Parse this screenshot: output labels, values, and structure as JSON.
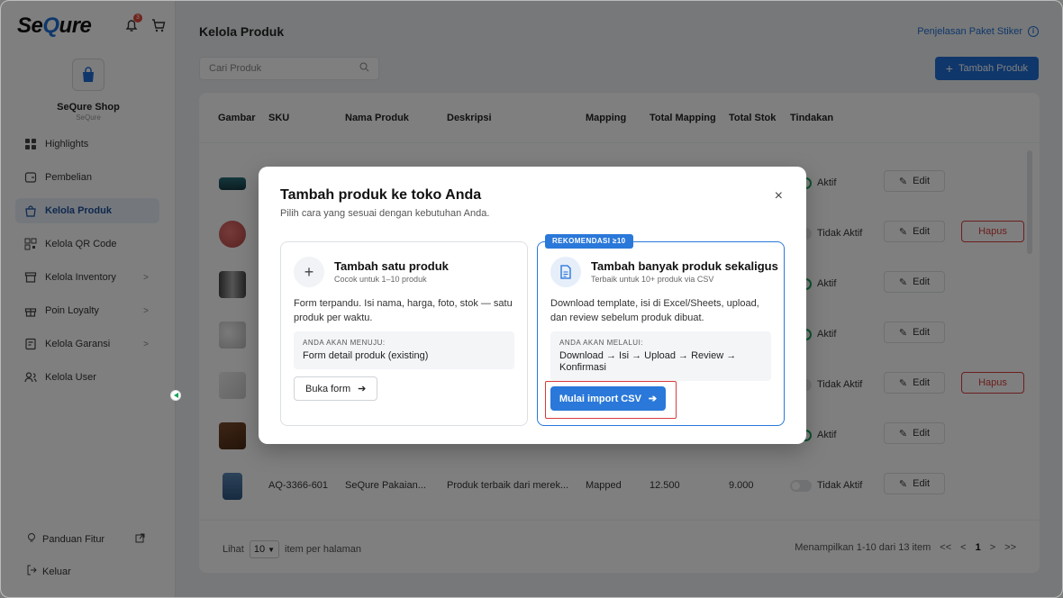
{
  "app": {
    "logo_text_before": "Se",
    "logo_text_q": "Q",
    "logo_text_after": "ure",
    "notification_count": "3"
  },
  "shop": {
    "name": "SeQure Shop",
    "subtitle": "SeQure"
  },
  "sidebar": {
    "items": [
      {
        "label": "Highlights",
        "icon": "grid-icon"
      },
      {
        "label": "Pembelian",
        "icon": "receipt-icon"
      },
      {
        "label": "Kelola Produk",
        "icon": "bag-icon"
      },
      {
        "label": "Kelola QR Code",
        "icon": "qr-icon"
      },
      {
        "label": "Kelola Inventory",
        "icon": "box-icon"
      },
      {
        "label": "Poin Loyalty",
        "icon": "gift-icon"
      },
      {
        "label": "Kelola Garansi",
        "icon": "shield-icon"
      },
      {
        "label": "Kelola User",
        "icon": "users-icon"
      }
    ],
    "footer": {
      "guide": "Panduan Fitur",
      "logout": "Keluar"
    }
  },
  "header": {
    "title": "Kelola Produk",
    "sticker_link": "Penjelasan Paket Stiker",
    "info_symbol": "i",
    "search_placeholder": "Cari Produk",
    "add_button": "Tambah Produk"
  },
  "table": {
    "columns": [
      "Gambar",
      "SKU",
      "Nama Produk",
      "Deskripsi",
      "Mapping",
      "Total Mapping",
      "Total Stok",
      "Tindakan"
    ],
    "edit_label": "Edit",
    "delete_label": "Hapus",
    "rows": [
      {
        "status": "Aktif",
        "active": true,
        "deletable": false
      },
      {
        "status": "Tidak Aktif",
        "active": false,
        "deletable": true
      },
      {
        "status": "Aktif",
        "active": true,
        "deletable": false
      },
      {
        "status": "Aktif",
        "active": true,
        "deletable": false
      },
      {
        "status": "Tidak Aktif",
        "active": false,
        "deletable": true
      },
      {
        "status": "Aktif",
        "active": true,
        "deletable": false
      },
      {
        "sku": "AQ-3366-601",
        "name": "SeQure Pakaian...",
        "desc": "Produk terbaik dari merek...",
        "mapping": "Mapped",
        "total_mapping": "12.500",
        "total_stock": "9.000",
        "status": "Tidak Aktif",
        "active": false,
        "deletable": false
      }
    ]
  },
  "pagination": {
    "show_label": "Lihat",
    "per_page": "10",
    "per_page_suffix": "item per halaman",
    "summary": "Menampilkan 1-10 dari 13 item",
    "first": "<<",
    "prev": "<",
    "current": "1",
    "next": ">",
    "last": ">>"
  },
  "modal": {
    "title": "Tambah produk ke toko Anda",
    "subtitle": "Pilih cara yang sesuai dengan kebutuhan Anda.",
    "close": "×",
    "single": {
      "title": "Tambah satu produk",
      "subtitle": "Cocok untuk 1–10 produk",
      "description": "Form terpandu. Isi nama, harga, foto, stok — satu produk per waktu.",
      "box_label": "ANDA AKAN MENUJU:",
      "box_value": "Form detail produk (existing)",
      "button": "Buka form"
    },
    "bulk": {
      "badge": "REKOMENDASI ≥10",
      "title": "Tambah banyak produk sekaligus",
      "subtitle": "Terbaik untuk 10+ produk via CSV",
      "description": "Download template, isi di Excel/Sheets, upload, dan review sebelum produk dibuat.",
      "box_label": "ANDA AKAN MELALUI:",
      "box_value": "Download → Isi → Upload → Review → Konfirmasi",
      "button": "Mulai import CSV"
    }
  },
  "colors": {
    "primary": "#1f6fd6",
    "danger": "#d93c3c",
    "success": "#1aa35a"
  }
}
